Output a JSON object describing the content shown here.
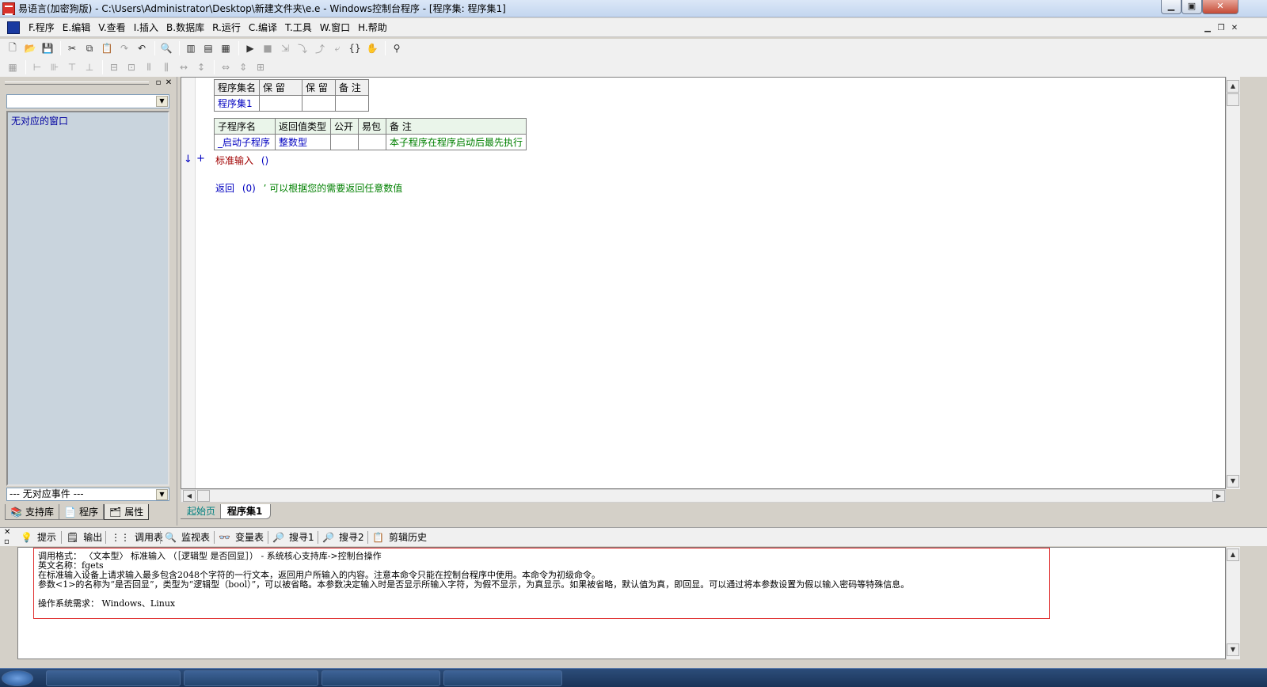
{
  "window": {
    "title": "易语言(加密狗版) - C:\\Users\\Administrator\\Desktop\\新建文件夹\\e.e - Windows控制台程序 - [程序集: 程序集1]"
  },
  "menu": [
    {
      "label": "F.程序"
    },
    {
      "label": "E.编辑"
    },
    {
      "label": "V.查看"
    },
    {
      "label": "I.插入"
    },
    {
      "label": "B.数据库"
    },
    {
      "label": "R.运行"
    },
    {
      "label": "C.编译"
    },
    {
      "label": "T.工具"
    },
    {
      "label": "W.窗口"
    },
    {
      "label": "H.帮助"
    }
  ],
  "left_panel": {
    "window_list_text": "无对应的窗口",
    "event_combo_value": "--- 无对应事件 ---",
    "tabs": [
      {
        "label": "支持库"
      },
      {
        "label": "程序"
      },
      {
        "label": "属性"
      }
    ]
  },
  "editor": {
    "assembly_table": {
      "headers": [
        "程序集名",
        "保 留",
        "保 留",
        "备 注"
      ],
      "row": [
        "程序集1",
        "",
        "",
        ""
      ]
    },
    "sub_table": {
      "headers": [
        "子程序名",
        "返回值类型",
        "公开",
        "易包",
        "备 注"
      ],
      "row": [
        "_启动子程序",
        "整数型",
        "",
        "",
        "本子程序在程序启动后最先执行"
      ]
    },
    "code_line_1": {
      "cmd": "标准输入",
      "args": "()"
    },
    "code_line_2": {
      "cmd": "返回",
      "args": "(0)",
      "comment": "’ 可以根据您的需要返回任意数值"
    },
    "gutter_arrow": "↓",
    "gutter_plus": "+"
  },
  "doc_tabs": [
    {
      "label": "起始页"
    },
    {
      "label": "程序集1"
    }
  ],
  "bottom_tabs": [
    {
      "label": "提示"
    },
    {
      "label": "输出"
    },
    {
      "label": "调用表"
    },
    {
      "label": "监视表"
    },
    {
      "label": "变量表"
    },
    {
      "label": "搜寻1"
    },
    {
      "label": "搜寻2"
    },
    {
      "label": "剪辑历史"
    }
  ],
  "hint": {
    "line1": "调用格式： 〈文本型〉 标准输入 （［逻辑型 是否回显］） - 系统核心支持库->控制台操作",
    "line2": "英文名称：fgets",
    "line3": "在标准输入设备上请求输入最多包含2048个字符的一行文本，返回用户所输入的内容。注意本命令只能在控制台程序中使用。本命令为初级命令。",
    "line4": "参数<1>的名称为“是否回显”，类型为“逻辑型（bool）”，可以被省略。本参数决定输入时是否显示所输入字符，为假不显示，为真显示。如果被省略，默认值为真，即回显。可以通过将本参数设置为假以输入密码等特殊信息。",
    "line5": "操作系统需求： Windows、Linux"
  },
  "colors": {
    "hint_border": "#e03030",
    "keyword_blue": "#0000c0",
    "comment_green": "#008000"
  }
}
